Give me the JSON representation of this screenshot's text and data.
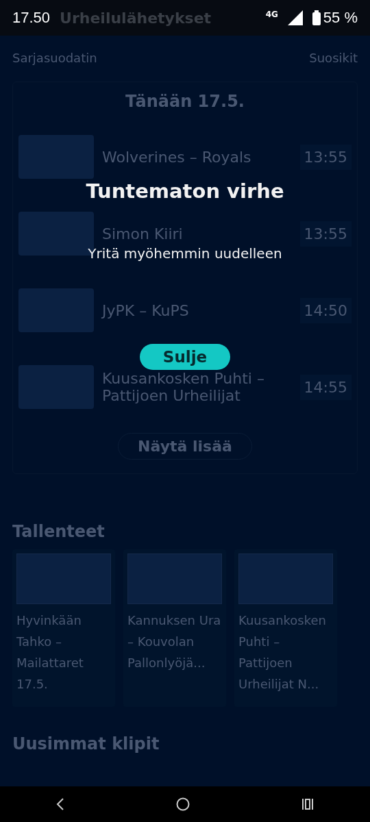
{
  "status_bar": {
    "time": "17.50",
    "network": "4G",
    "battery": "55 %"
  },
  "header": {
    "title": "Urheilulähetykset",
    "filter": "Sarjasuodatin",
    "favorites": "Suosikit"
  },
  "today": {
    "heading": "Tänään 17.5.",
    "matches": [
      {
        "title": "Wolverines – Royals",
        "time": "13:55"
      },
      {
        "title": "Simon Kiiri",
        "time": "13:55"
      },
      {
        "title": "JyPK – KuPS",
        "time": "14:50"
      },
      {
        "title": "Kuusankosken Puhti – Pattijoen Urheilijat",
        "time": "14:55"
      }
    ],
    "more_button": "Näytä lisää"
  },
  "recordings": {
    "heading": "Tallenteet",
    "items": [
      {
        "title": "Hyvinkään Tahko – Mailattaret 17.5."
      },
      {
        "title": "Kannuksen Ura – Kouvolan Pallonlyöjä..."
      },
      {
        "title": "Kuusankosken Puhti – Pattijoen Urheilijat N..."
      }
    ]
  },
  "clips": {
    "heading": "Uusimmat klipit"
  },
  "dialog": {
    "title": "Tuntematon virhe",
    "message": "Yritä myöhemmin uudelleen",
    "button": "Sulje"
  }
}
